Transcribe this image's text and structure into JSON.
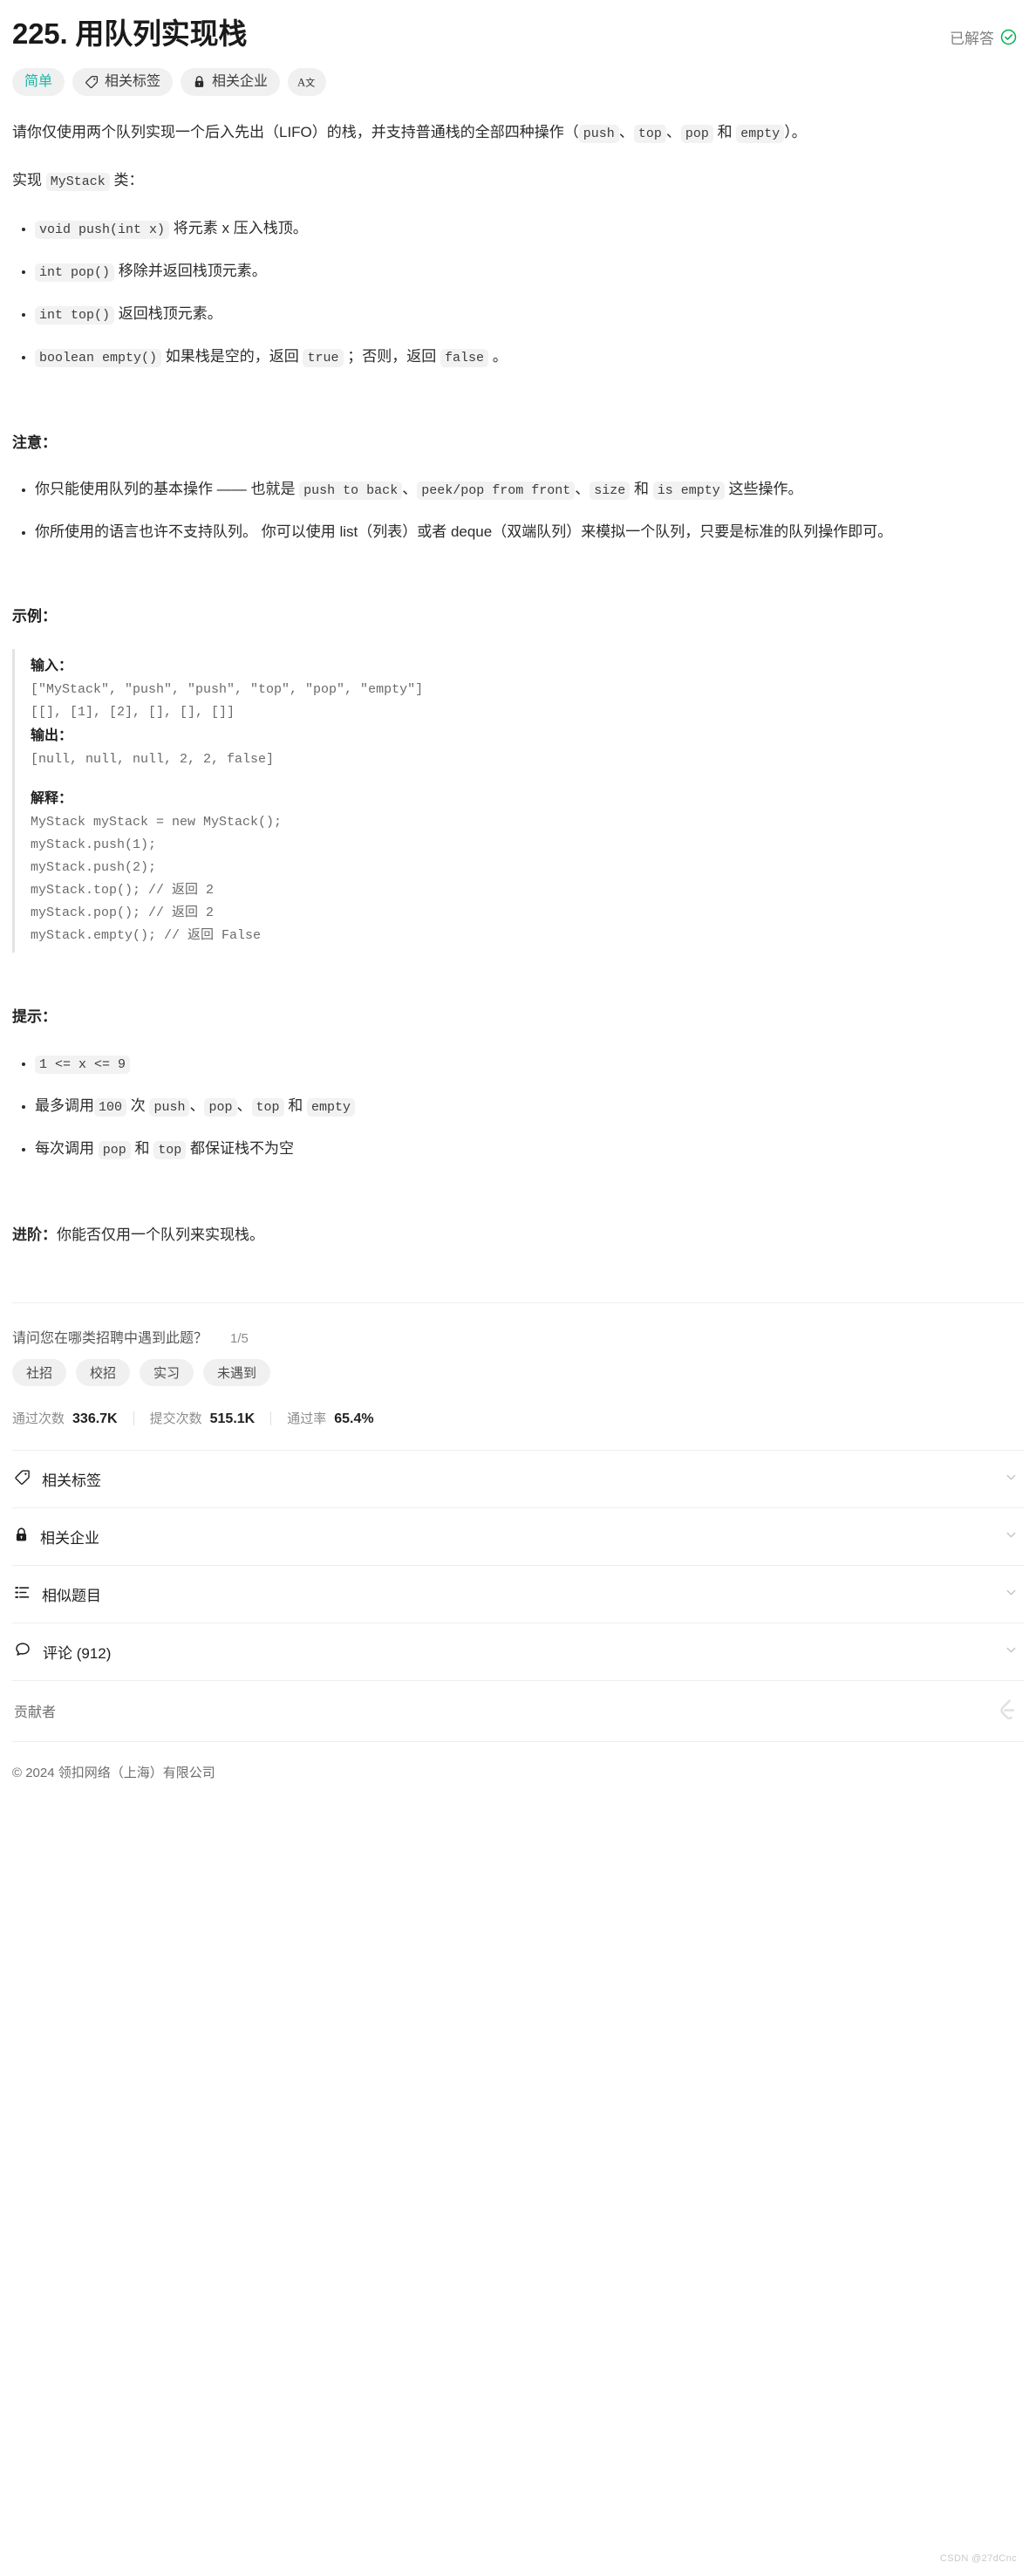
{
  "header": {
    "title": "225. 用队列实现栈",
    "status_text": "已解答",
    "status_icon": "check-circle-icon",
    "status_color": "#00af54"
  },
  "pills": [
    {
      "label": "简单",
      "icon": null,
      "name": "difficulty-badge"
    },
    {
      "label": "相关标签",
      "icon": "tag-icon",
      "name": "related-tags-button"
    },
    {
      "label": "相关企业",
      "icon": "lock-icon",
      "name": "related-companies-button"
    },
    {
      "label": "",
      "icon": "font-size-icon",
      "name": "font-size-button"
    }
  ],
  "description": {
    "intro_1": "请你仅使用两个队列实现一个后入先出（LIFO）的栈，并支持普通栈的全部四种操作（",
    "code_push": "push",
    "sep_1": "、",
    "code_top": "top",
    "sep_2": "、",
    "code_pop": "pop",
    "sep_3": " 和 ",
    "code_empty": "empty",
    "intro_2": "）。",
    "implement_prefix": "实现 ",
    "implement_code": "MyStack",
    "implement_suffix": " 类：",
    "methods": [
      {
        "code": "void push(int x)",
        "text": " 将元素 x 压入栈顶。"
      },
      {
        "code": "int pop()",
        "text": " 移除并返回栈顶元素。"
      },
      {
        "code": "int top()",
        "text": " 返回栈顶元素。"
      },
      {
        "code": "boolean empty()",
        "text_before": " 如果栈是空的，返回 ",
        "code_true": "true",
        "text_mid": " ；否则，返回 ",
        "code_false": "false",
        "text_after": " 。"
      }
    ]
  },
  "notes": {
    "heading": "注意：",
    "item1_a": "你只能使用队列的基本操作 —— 也就是 ",
    "item1_c1": "push to back",
    "item1_b": "、",
    "item1_c2": "peek/pop from front",
    "item1_d": "、",
    "item1_c3": "size",
    "item1_e": " 和 ",
    "item1_c4": "is empty",
    "item1_f": " 这些操作。",
    "item2": "你所使用的语言也许不支持队列。 你可以使用 list（列表）或者 deque（双端队列）来模拟一个队列，只要是标准的队列操作即可。"
  },
  "example": {
    "heading": "示例：",
    "input_label": "输入：",
    "input_line1": "[\"MyStack\", \"push\", \"push\", \"top\", \"pop\", \"empty\"]",
    "input_line2": "[[], [1], [2], [], [], []]",
    "output_label": "输出：",
    "output_line": "[null, null, null, 2, 2, false]",
    "explain_label": "解释：",
    "explain_lines": [
      "MyStack myStack = new MyStack();",
      "myStack.push(1);",
      "myStack.push(2);",
      "myStack.top(); // 返回 2",
      "myStack.pop(); // 返回 2",
      "myStack.empty(); // 返回 False"
    ]
  },
  "hints": {
    "heading": "提示：",
    "item1_code": "1 <= x <= 9",
    "item2_a": "最多调用",
    "item2_c1": "100",
    "item2_b": " 次 ",
    "item2_c2": "push",
    "item2_s1": "、",
    "item2_c3": "pop",
    "item2_s2": "、",
    "item2_c4": "top",
    "item2_s3": " 和 ",
    "item2_c5": "empty",
    "item3_a": "每次调用 ",
    "item3_c1": "pop",
    "item3_b": " 和 ",
    "item3_c2": "top",
    "item3_c": " 都保证栈不为空"
  },
  "followup": {
    "label": "进阶：",
    "text": "你能否仅用一个队列来实现栈。"
  },
  "survey": {
    "question": "请问您在哪类招聘中遇到此题？",
    "counter": "1/5",
    "options": [
      "社招",
      "校招",
      "实习",
      "未遇到"
    ]
  },
  "stats": [
    {
      "label": "通过次数",
      "value": "336.7K"
    },
    {
      "label": "提交次数",
      "value": "515.1K"
    },
    {
      "label": "通过率",
      "value": "65.4%"
    }
  ],
  "accordions": [
    {
      "label": "相关标签",
      "icon": "tag-icon",
      "name": "accordion-related-tags"
    },
    {
      "label": "相关企业",
      "icon": "lock-icon",
      "name": "accordion-related-companies"
    },
    {
      "label": "相似题目",
      "icon": "list-icon",
      "name": "accordion-similar-questions"
    },
    {
      "label": "评论 (912)",
      "icon": "comment-icon",
      "name": "accordion-comments"
    }
  ],
  "contributors": {
    "label": "贡献者",
    "avatar_icon": "leetcode-logo-icon"
  },
  "footer": {
    "copyright": "© 2024 领扣网络（上海）有限公司"
  },
  "watermark": {
    "text": "CSDN @27dCnc"
  }
}
